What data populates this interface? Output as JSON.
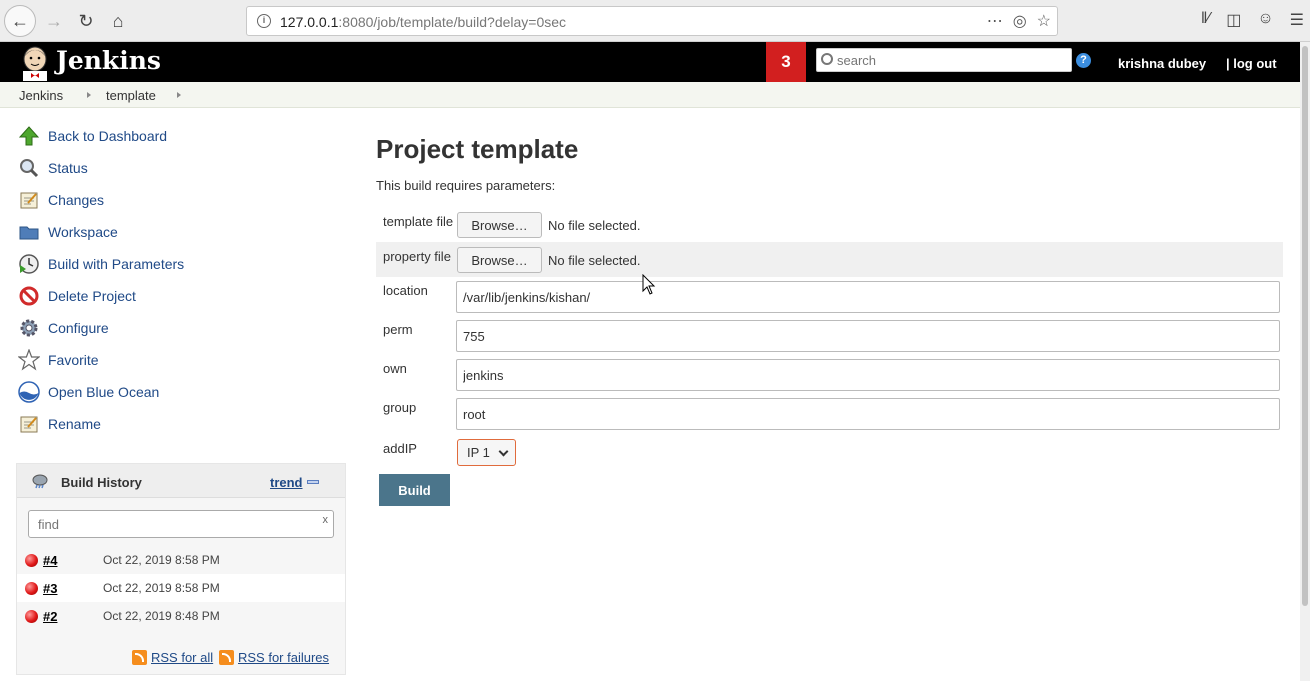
{
  "browser": {
    "url_host": "127.0.0.1",
    "url_rest": ":8080/job/template/build?delay=0sec"
  },
  "header": {
    "app_name": "Jenkins",
    "notification_count": "3",
    "search_placeholder": "search",
    "help": "?",
    "user": "krishna dubey",
    "logout": "| log out"
  },
  "breadcrumb": [
    "Jenkins",
    "template"
  ],
  "sidebar": {
    "tasks": [
      {
        "label": "Back to Dashboard",
        "icon": "up-arrow-icon"
      },
      {
        "label": "Status",
        "icon": "magnifier-icon"
      },
      {
        "label": "Changes",
        "icon": "notepad-icon"
      },
      {
        "label": "Workspace",
        "icon": "folder-icon"
      },
      {
        "label": "Build with Parameters",
        "icon": "clock-play-icon"
      },
      {
        "label": "Delete Project",
        "icon": "no-entry-icon"
      },
      {
        "label": "Configure",
        "icon": "gear-icon"
      },
      {
        "label": "Favorite",
        "icon": "star-icon"
      },
      {
        "label": "Open Blue Ocean",
        "icon": "blue-ocean-icon"
      },
      {
        "label": "Rename",
        "icon": "notepad-icon"
      }
    ]
  },
  "build_history": {
    "title": "Build History",
    "trend": "trend",
    "find_placeholder": "find",
    "clear": "x",
    "builds": [
      {
        "num": "#4",
        "date": "Oct 22, 2019 8:58 PM"
      },
      {
        "num": "#3",
        "date": "Oct 22, 2019 8:58 PM"
      },
      {
        "num": "#2",
        "date": "Oct 22, 2019 8:48 PM"
      }
    ],
    "rss_all": "RSS for all",
    "rss_failures": "RSS for failures"
  },
  "main": {
    "title": "Project template",
    "subtitle": "This build requires parameters:",
    "browse_label": "Browse…",
    "no_file": "No file selected.",
    "params": {
      "template_file": "template file",
      "property_file": "property file",
      "location": {
        "label": "location",
        "value": "/var/lib/jenkins/kishan/"
      },
      "perm": {
        "label": "perm",
        "value": "755"
      },
      "own": {
        "label": "own",
        "value": "jenkins"
      },
      "group": {
        "label": "group",
        "value": "root"
      },
      "addIP": {
        "label": "addIP",
        "value": "IP 1"
      }
    },
    "build_button": "Build"
  }
}
